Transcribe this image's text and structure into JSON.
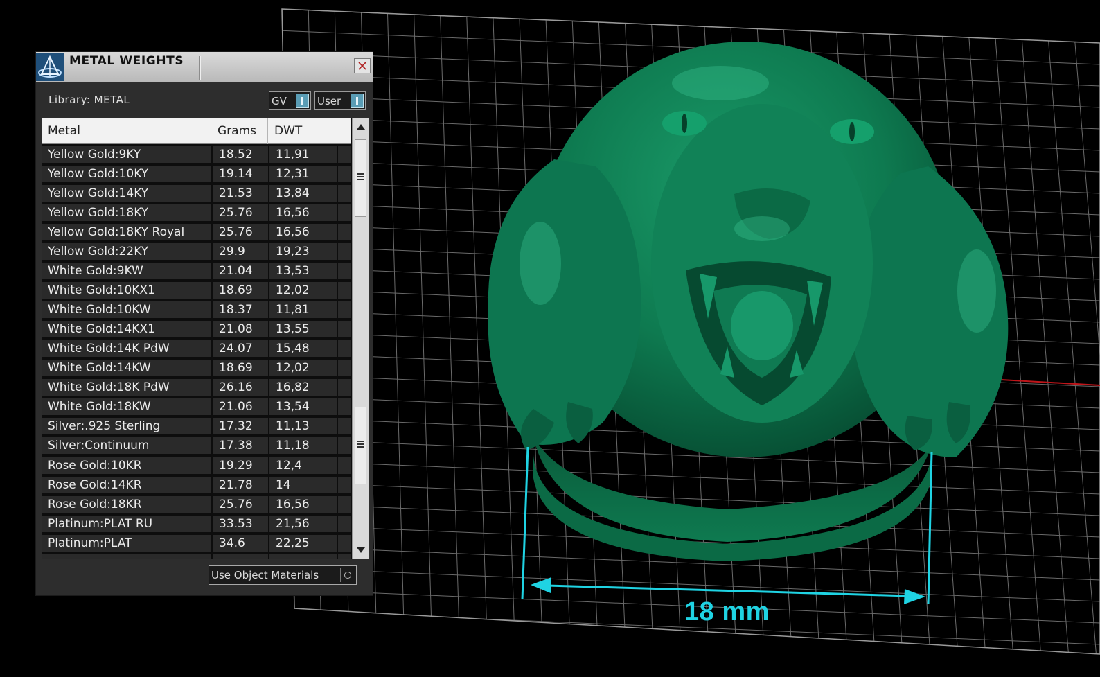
{
  "panel": {
    "title": "METAL WEIGHTS",
    "library_label": "Library: METAL",
    "toggles": [
      {
        "label": "GV",
        "state": "on"
      },
      {
        "label": "User",
        "state": "on"
      }
    ],
    "columns": [
      "Metal",
      "Grams",
      "DWT"
    ],
    "rows": [
      {
        "metal": "Yellow Gold:9KY",
        "grams": "18.52",
        "dwt": "11,91"
      },
      {
        "metal": "Yellow Gold:10KY",
        "grams": "19.14",
        "dwt": "12,31"
      },
      {
        "metal": "Yellow Gold:14KY",
        "grams": "21.53",
        "dwt": "13,84"
      },
      {
        "metal": "Yellow Gold:18KY",
        "grams": "25.76",
        "dwt": "16,56"
      },
      {
        "metal": "Yellow Gold:18KY Royal",
        "grams": "25.76",
        "dwt": "16,56"
      },
      {
        "metal": "Yellow Gold:22KY",
        "grams": "29.9",
        "dwt": "19,23"
      },
      {
        "metal": "White Gold:9KW",
        "grams": "21.04",
        "dwt": "13,53"
      },
      {
        "metal": "White Gold:10KX1",
        "grams": "18.69",
        "dwt": "12,02"
      },
      {
        "metal": "White Gold:10KW",
        "grams": "18.37",
        "dwt": "11,81"
      },
      {
        "metal": "White Gold:14KX1",
        "grams": "21.08",
        "dwt": "13,55"
      },
      {
        "metal": "White Gold:14K PdW",
        "grams": "24.07",
        "dwt": "15,48"
      },
      {
        "metal": "White Gold:14KW",
        "grams": "18.69",
        "dwt": "12,02"
      },
      {
        "metal": "White Gold:18K PdW",
        "grams": "26.16",
        "dwt": "16,82"
      },
      {
        "metal": "White Gold:18KW",
        "grams": "21.06",
        "dwt": "13,54"
      },
      {
        "metal": "Silver:.925 Sterling",
        "grams": "17.32",
        "dwt": "11,13"
      },
      {
        "metal": "Silver:Continuum",
        "grams": "17.38",
        "dwt": "11,18"
      },
      {
        "metal": "Rose Gold:10KR",
        "grams": "19.29",
        "dwt": "12,4"
      },
      {
        "metal": "Rose Gold:14KR",
        "grams": "21.78",
        "dwt": "14"
      },
      {
        "metal": "Rose Gold:18KR",
        "grams": "25.76",
        "dwt": "16,56"
      },
      {
        "metal": "Platinum:PLAT RU",
        "grams": "33.53",
        "dwt": "21,56"
      },
      {
        "metal": "Platinum:PLAT",
        "grams": "34.6",
        "dwt": "22,25"
      }
    ],
    "use_object_materials_label": "Use Object Materials"
  },
  "viewport": {
    "dimension_label": "18 mm",
    "model_color": "#0f7a52",
    "dimension_color": "#1fd3e3",
    "grid_color": "#8a8a8a",
    "axis_color": "#c0151a"
  }
}
